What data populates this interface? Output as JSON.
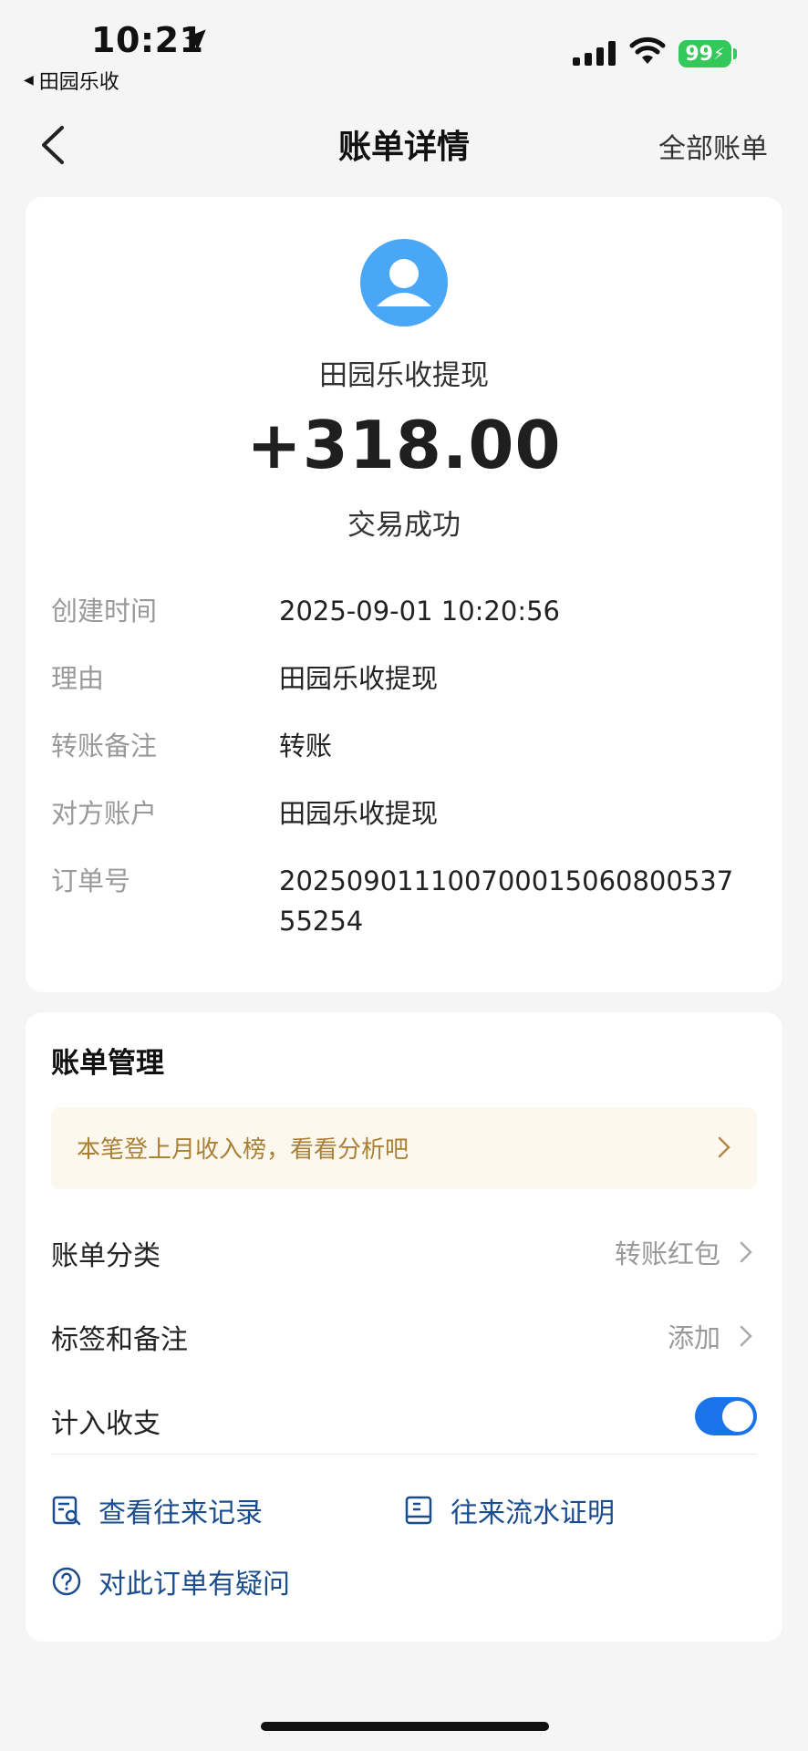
{
  "status_bar": {
    "time": "10:21",
    "back_app": "田园乐收",
    "battery": "99"
  },
  "nav": {
    "title": "账单详情",
    "right_link": "全部账单"
  },
  "transaction": {
    "merchant": "田园乐收提现",
    "amount": "+318.00",
    "status": "交易成功"
  },
  "details": [
    {
      "label": "创建时间",
      "value": "2025-09-01 10:20:56"
    },
    {
      "label": "理由",
      "value": "田园乐收提现"
    },
    {
      "label": "转账备注",
      "value": "转账"
    },
    {
      "label": "对方账户",
      "value": "田园乐收提现"
    },
    {
      "label": "订单号",
      "value": "20250901110070001506080053755254"
    }
  ],
  "management": {
    "title": "账单管理",
    "tip": "本笔登上月收入榜，看看分析吧",
    "category_label": "账单分类",
    "category_value": "转账红包",
    "tags_label": "标签和备注",
    "tags_value": "添加",
    "include_label": "计入收支",
    "include_on": true,
    "link_records": "查看往来记录",
    "link_proof": "往来流水证明",
    "link_question": "对此订单有疑问"
  },
  "colors": {
    "accent": "#1a73e8",
    "link": "#1a4d8f",
    "avatar": "#4aa7f6",
    "tip_bg": "#fdf8ee",
    "tip_text": "#a98035",
    "battery": "#34c759"
  }
}
